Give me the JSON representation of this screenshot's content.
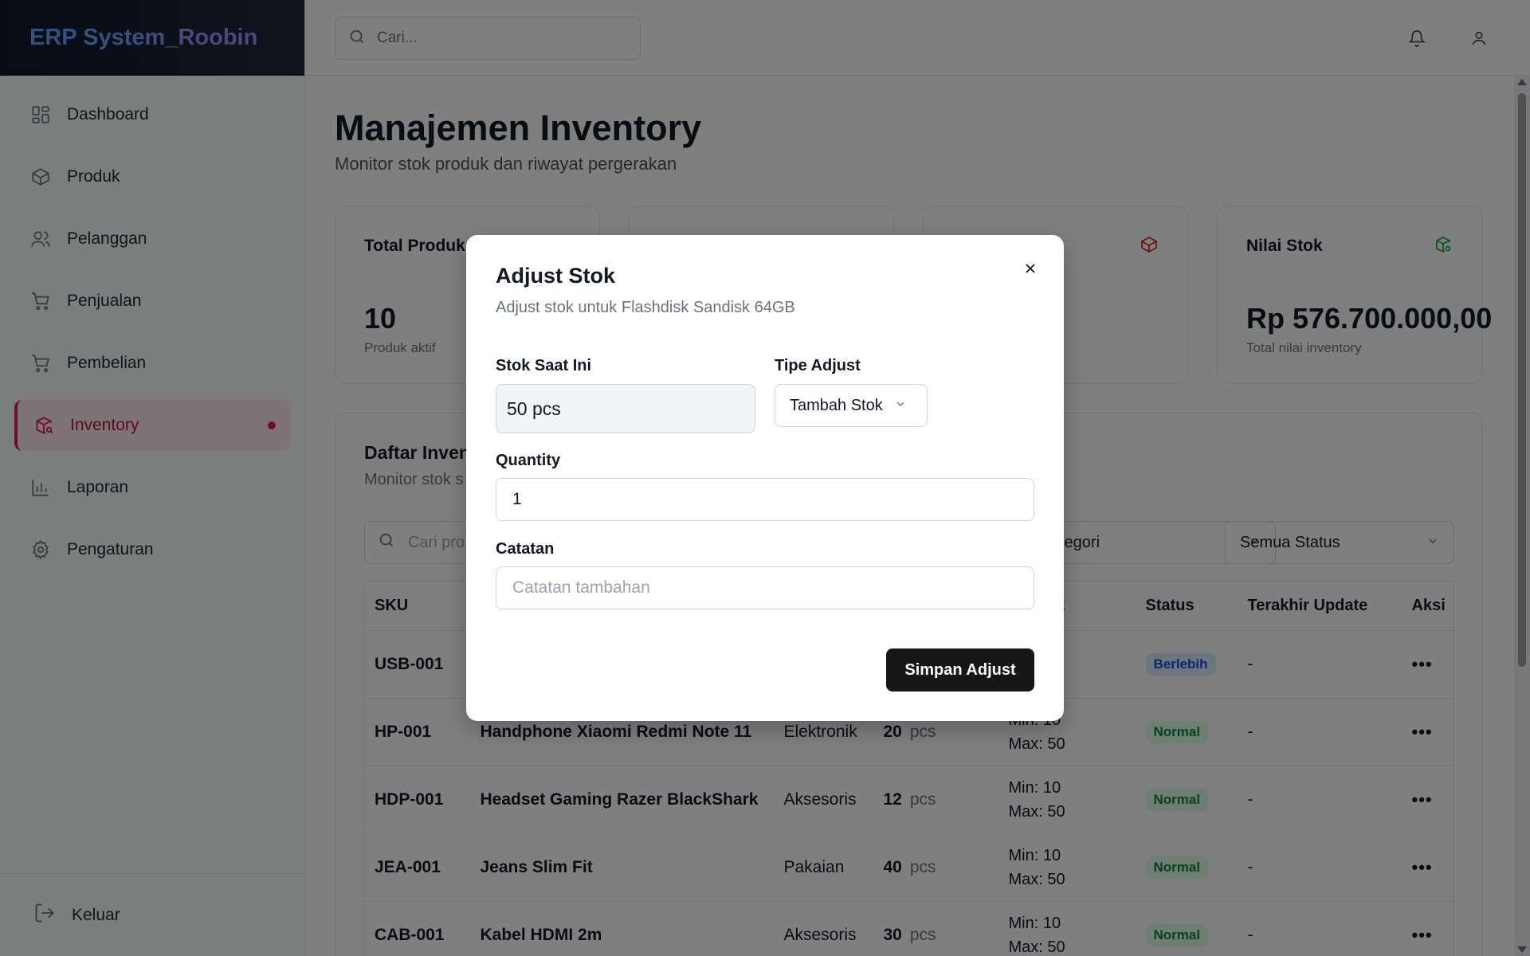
{
  "app": {
    "brand": "ERP System_Roobin"
  },
  "search": {
    "placeholder": "Cari..."
  },
  "sidebar": {
    "items": [
      {
        "label": "Dashboard",
        "icon": "grid-icon"
      },
      {
        "label": "Produk",
        "icon": "box-icon"
      },
      {
        "label": "Pelanggan",
        "icon": "users-icon"
      },
      {
        "label": "Penjualan",
        "icon": "cart-icon"
      },
      {
        "label": "Pembelian",
        "icon": "cart-icon"
      },
      {
        "label": "Inventory",
        "icon": "package-search-icon",
        "active": true
      },
      {
        "label": "Laporan",
        "icon": "bar-chart-icon"
      },
      {
        "label": "Pengaturan",
        "icon": "gear-icon"
      }
    ],
    "logout": "Keluar"
  },
  "page": {
    "title": "Manajemen Inventory",
    "subtitle": "Monitor stok produk dan riwayat pergerakan"
  },
  "cards": [
    {
      "title": "Total Produk",
      "value": "10",
      "sub": "Produk aktif"
    },
    {
      "title": "",
      "value": "",
      "sub": ""
    },
    {
      "title": "",
      "value": "",
      "sub": ""
    },
    {
      "title": "Nilai Stok",
      "value": "Rp 576.700.000,00",
      "sub": "Total nilai inventory"
    }
  ],
  "list": {
    "title": "Daftar Inventory",
    "subtitle": "Monitor stok s",
    "search_placeholder": "Cari pro",
    "category_filter": "tegori",
    "status_filter": "Semua Status",
    "headers": [
      "SKU",
      "",
      "",
      "",
      "ax Stok",
      "Status",
      "Terakhir Update",
      "Aksi"
    ],
    "rows": [
      {
        "sku": "USB-001",
        "name": "",
        "category": "",
        "stock": "",
        "unit": "",
        "min": "",
        "max": "",
        "status": "Berlebih",
        "updated": "-"
      },
      {
        "sku": "HP-001",
        "name": "Handphone Xiaomi Redmi Note 11",
        "category": "Elektronik",
        "stock": "20",
        "unit": "pcs",
        "min": "Min: 10",
        "max": "Max: 50",
        "status": "Normal",
        "updated": "-"
      },
      {
        "sku": "HDP-001",
        "name": "Headset Gaming Razer BlackShark",
        "category": "Aksesoris",
        "stock": "12",
        "unit": "pcs",
        "min": "Min: 10",
        "max": "Max: 50",
        "status": "Normal",
        "updated": "-"
      },
      {
        "sku": "JEA-001",
        "name": "Jeans Slim Fit",
        "category": "Pakaian",
        "stock": "40",
        "unit": "pcs",
        "min": "Min: 10",
        "max": "Max: 50",
        "status": "Normal",
        "updated": "-"
      },
      {
        "sku": "CAB-001",
        "name": "Kabel HDMI 2m",
        "category": "Aksesoris",
        "stock": "30",
        "unit": "pcs",
        "min": "Min: 10",
        "max": "Max: 50",
        "status": "Normal",
        "updated": "-"
      }
    ]
  },
  "modal": {
    "title": "Adjust Stok",
    "subtitle": "Adjust stok untuk Flashdisk Sandisk 64GB",
    "current_stock_label": "Stok Saat Ini",
    "current_stock_value": "50 pcs",
    "type_label": "Tipe Adjust",
    "type_value": "Tambah Stok",
    "quantity_label": "Quantity",
    "quantity_value": "1",
    "note_label": "Catatan",
    "note_placeholder": "Catatan tambahan",
    "submit": "Simpan Adjust"
  },
  "colors": {
    "accent": "#e11d48",
    "primary_button": "#171717",
    "overlay": "rgba(0,0,0,0.5)"
  }
}
